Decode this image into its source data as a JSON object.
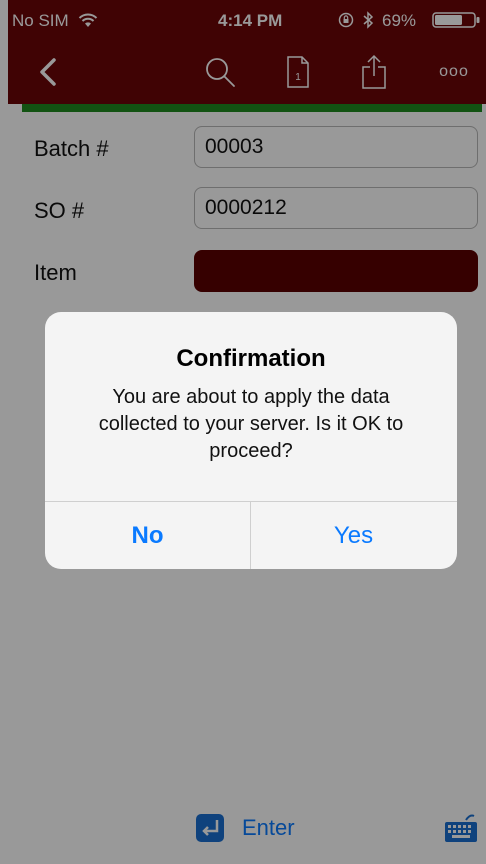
{
  "status_bar": {
    "carrier": "No SIM",
    "time": "4:14 PM",
    "battery": "69%",
    "icons": [
      "wifi-icon",
      "rotation-lock-icon",
      "bluetooth-icon",
      "battery-icon"
    ]
  },
  "nav": {
    "icons": [
      "back-chevron-icon",
      "search-icon",
      "document-icon",
      "share-icon",
      "more-icon"
    ],
    "doc_number": "1",
    "more_glyph": "ooo"
  },
  "form": {
    "batch_label": "Batch #",
    "batch_value": "00003",
    "so_label": "SO #",
    "so_value": "0000212",
    "item_label": "Item",
    "item_value": ""
  },
  "bottom_bar": {
    "enter_label": "Enter",
    "icons": [
      "enter-icon",
      "keyboard-icon"
    ]
  },
  "dialog": {
    "title": "Confirmation",
    "message": "You are about to apply the data collected to your server.  Is it OK to proceed?",
    "no_label": "No",
    "yes_label": "Yes"
  },
  "colors": {
    "brand": "#6b0508",
    "accent": "#0a7aff",
    "progress": "#1e8a1e",
    "item_field": "#5a0000"
  }
}
